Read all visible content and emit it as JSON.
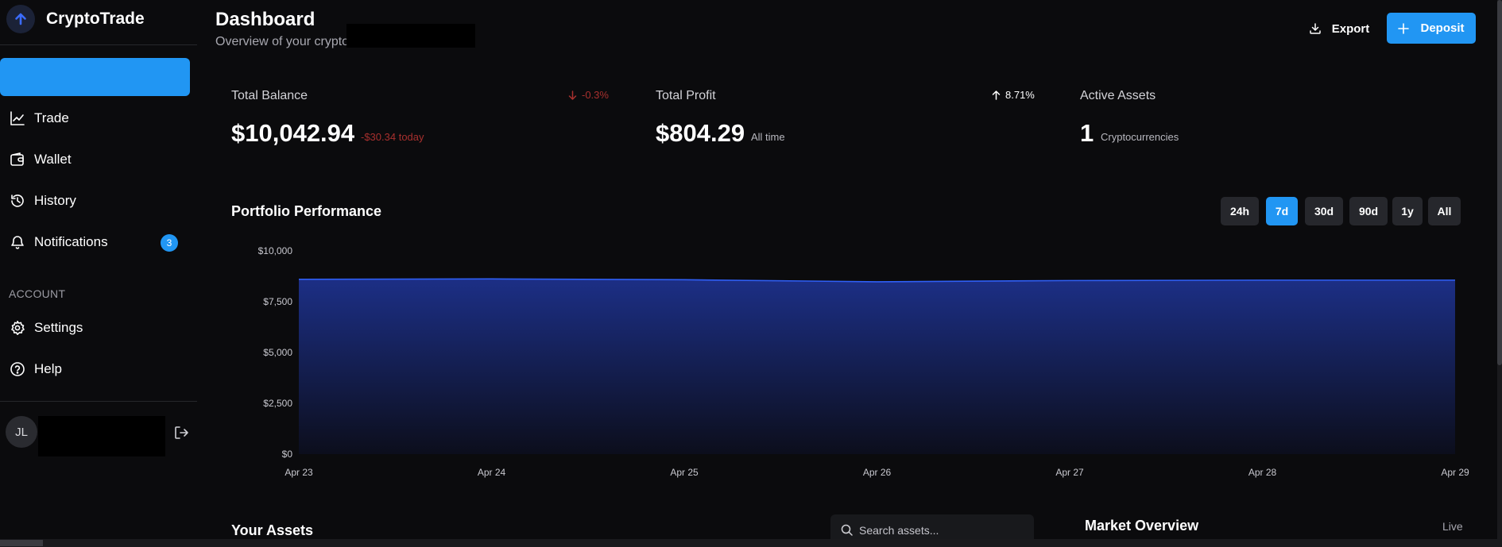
{
  "app": {
    "brand_name": "CryptoTrade",
    "brand_icon": "arrow-up-icon",
    "accent_color": "#2196f3"
  },
  "sidebar": {
    "items": [
      {
        "label": "Trade",
        "icon": "line-chart-icon"
      },
      {
        "label": "Wallet",
        "icon": "wallet-icon"
      },
      {
        "label": "History",
        "icon": "history-icon"
      },
      {
        "label": "Notifications",
        "icon": "bell-icon",
        "badge": "3"
      }
    ],
    "account_section_label": "ACCOUNT",
    "account_items": [
      {
        "label": "Settings",
        "icon": "gear-icon"
      },
      {
        "label": "Help",
        "icon": "help-circle-icon"
      }
    ],
    "user": {
      "initials": "JL"
    }
  },
  "header": {
    "title": "Dashboard",
    "subtitle": "Overview of your crypto",
    "export_label": "Export",
    "deposit_label": "Deposit"
  },
  "stats": {
    "total_balance": {
      "label": "Total Balance",
      "change": "-0.3%",
      "value": "$10,042.94",
      "sub": "-$30.34 today"
    },
    "total_profit": {
      "label": "Total Profit",
      "change": "8.71%",
      "value": "$804.29",
      "sub": "All time"
    },
    "active_assets": {
      "label": "Active Assets",
      "value": "1",
      "sub": "Cryptocurrencies"
    }
  },
  "performance": {
    "title": "Portfolio Performance",
    "ranges": [
      "24h",
      "7d",
      "30d",
      "90d",
      "1y",
      "All"
    ],
    "selected_range": "7d"
  },
  "chart_data": {
    "type": "area",
    "x": [
      "Apr 23",
      "Apr 24",
      "Apr 25",
      "Apr 26",
      "Apr 27",
      "Apr 28",
      "Apr 29"
    ],
    "series": [
      {
        "values": [
          8600,
          8620,
          8580,
          8480,
          8540,
          8560,
          8560
        ],
        "color": "#2f5ff5"
      }
    ],
    "y_ticks": [
      "$0",
      "$2,500",
      "$5,000",
      "$7,500",
      "$10,000"
    ],
    "ylim": [
      0,
      10000
    ],
    "grid": false,
    "xlabel": "",
    "ylabel": ""
  },
  "assets": {
    "title": "Your Assets",
    "search_placeholder": "Search assets..."
  },
  "market": {
    "title": "Market Overview",
    "status": "Live"
  }
}
